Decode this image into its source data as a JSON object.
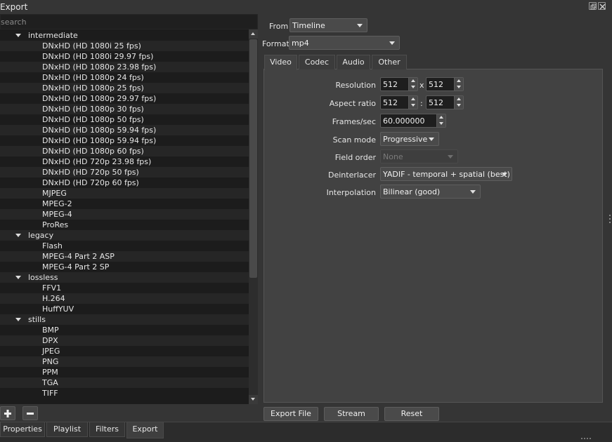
{
  "window": {
    "title": "Export"
  },
  "search": {
    "placeholder": "search"
  },
  "tree": [
    {
      "type": "group",
      "label": "intermediate"
    },
    {
      "type": "item",
      "label": "DNxHD (HD 1080i 25 fps)"
    },
    {
      "type": "item",
      "label": "DNxHD (HD 1080i 29.97 fps)"
    },
    {
      "type": "item",
      "label": "DNxHD (HD 1080p 23.98 fps)"
    },
    {
      "type": "item",
      "label": "DNxHD (HD 1080p 24 fps)"
    },
    {
      "type": "item",
      "label": "DNxHD (HD 1080p 25 fps)"
    },
    {
      "type": "item",
      "label": "DNxHD (HD 1080p 29.97 fps)"
    },
    {
      "type": "item",
      "label": "DNxHD (HD 1080p 30 fps)"
    },
    {
      "type": "item",
      "label": "DNxHD (HD 1080p 50 fps)"
    },
    {
      "type": "item",
      "label": "DNxHD (HD 1080p 59.94 fps)"
    },
    {
      "type": "item",
      "label": "DNxHD (HD 1080p 59.94 fps)"
    },
    {
      "type": "item",
      "label": "DNxHD (HD 1080p 60 fps)"
    },
    {
      "type": "item",
      "label": "DNxHD (HD 720p 23.98 fps)"
    },
    {
      "type": "item",
      "label": "DNxHD (HD 720p 50 fps)"
    },
    {
      "type": "item",
      "label": "DNxHD (HD 720p 60 fps)"
    },
    {
      "type": "item",
      "label": "MJPEG"
    },
    {
      "type": "item",
      "label": "MPEG-2"
    },
    {
      "type": "item",
      "label": "MPEG-4"
    },
    {
      "type": "item",
      "label": "ProRes"
    },
    {
      "type": "group",
      "label": "legacy"
    },
    {
      "type": "item",
      "label": "Flash"
    },
    {
      "type": "item",
      "label": "MPEG-4 Part 2 ASP"
    },
    {
      "type": "item",
      "label": "MPEG-4 Part 2 SP"
    },
    {
      "type": "group",
      "label": "lossless"
    },
    {
      "type": "item",
      "label": "FFV1"
    },
    {
      "type": "item",
      "label": "H.264"
    },
    {
      "type": "item",
      "label": "HuffYUV"
    },
    {
      "type": "group",
      "label": "stills"
    },
    {
      "type": "item",
      "label": "BMP"
    },
    {
      "type": "item",
      "label": "DPX"
    },
    {
      "type": "item",
      "label": "JPEG"
    },
    {
      "type": "item",
      "label": "PNG"
    },
    {
      "type": "item",
      "label": "PPM"
    },
    {
      "type": "item",
      "label": "TGA"
    },
    {
      "type": "item",
      "label": "TIFF"
    }
  ],
  "from": {
    "label": "From",
    "value": "Timeline"
  },
  "format": {
    "label": "Format",
    "value": "mp4"
  },
  "tabs": {
    "video": "Video",
    "codec": "Codec",
    "audio": "Audio",
    "other": "Other",
    "active": "Video"
  },
  "video": {
    "resolution_label": "Resolution",
    "width": "512",
    "res_sep": "x",
    "height": "512",
    "aspect_label": "Aspect ratio",
    "aspect_num": "512",
    "aspect_sep": ":",
    "aspect_den": "512",
    "fps_label": "Frames/sec",
    "fps": "60.000000",
    "scan_label": "Scan mode",
    "scan": "Progressive",
    "field_label": "Field order",
    "field": "None",
    "deint_label": "Deinterlacer",
    "deint": "YADIF - temporal + spatial (best)",
    "interp_label": "Interpolation",
    "interp": "Bilinear (good)"
  },
  "buttons": {
    "export_file": "Export File",
    "stream": "Stream",
    "reset": "Reset"
  },
  "dock_tabs": [
    {
      "label": "Properties"
    },
    {
      "label": "Playlist"
    },
    {
      "label": "Filters"
    },
    {
      "label": "Export",
      "active": true
    }
  ],
  "icons": {
    "add": "plus-icon",
    "remove": "minus-icon",
    "float": "float-window-icon",
    "close": "close-icon"
  }
}
